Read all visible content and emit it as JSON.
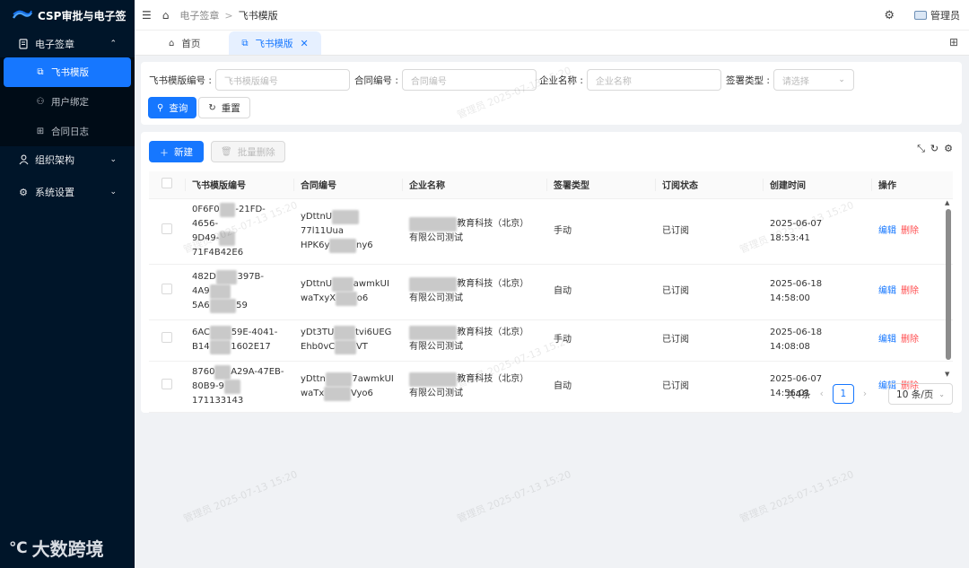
{
  "app": {
    "title": "CSP审批与电子签",
    "brand_footer": "大数跨境"
  },
  "sidebar": {
    "groups": [
      {
        "label": "电子签章",
        "arrow": "⌃",
        "items": [
          {
            "label": "飞书模版",
            "icon": "copy-icon"
          },
          {
            "label": "用户绑定",
            "icon": "user-bind-icon"
          },
          {
            "label": "合同日志",
            "icon": "grid-icon"
          }
        ]
      },
      {
        "label": "组织架构",
        "arrow": "⌄"
      },
      {
        "label": "系统设置",
        "arrow": "⌄"
      }
    ]
  },
  "header": {
    "breadcrumb": [
      "电子签章",
      "飞书模版"
    ],
    "user": "管理员"
  },
  "tabs": [
    {
      "label": "首页"
    },
    {
      "label": "飞书模版"
    }
  ],
  "search": {
    "fields": [
      {
        "label": "飞书模版编号 :",
        "placeholder": "飞书模版编号"
      },
      {
        "label": "合同编号 :",
        "placeholder": "合同编号"
      },
      {
        "label": "企业名称 :",
        "placeholder": "企业名称"
      },
      {
        "label": "签署类型 :",
        "placeholder": "请选择"
      }
    ],
    "query_label": "查询",
    "reset_label": "重置"
  },
  "toolbar": {
    "new_label": "新建",
    "batch_delete_label": "批量删除"
  },
  "table": {
    "columns": [
      "飞书模版编号",
      "合同编号",
      "企业名称",
      "签署类型",
      "订阅状态",
      "创建时间",
      "操作"
    ],
    "rows": [
      {
        "tpl1": "0F6F0",
        "tpl2": "-21FD-4656-",
        "tpl3": "9D49-",
        "tpl4": "71F4B42E6",
        "c1": "yDttnU",
        "c2": "77l11Uua",
        "c3": "HPK6y",
        "c4": "ny6",
        "e1": "教育科技（北京）",
        "e2": "有限公司测试",
        "sign": "手动",
        "status": "已订阅",
        "created": "2025-06-07 18:53:41"
      },
      {
        "tpl1": "482D",
        "tpl2": "397B-",
        "tpl3": "4A9",
        "tpl4": "59",
        "tpl5": "5A6",
        "c1": "yDttnU",
        "c2": "awmkUI",
        "c3": "waTxyX",
        "c4": "o6",
        "e1": "教育科技（北京）",
        "e2": "有限公司测试",
        "sign": "自动",
        "status": "已订阅",
        "created": "2025-06-18 14:58:00"
      },
      {
        "tpl1": "6AC",
        "tpl2": "59E-4041-",
        "tpl3": "B14",
        "tpl4": "1602E17",
        "c1": "yDt3TU",
        "c2": "tvi6UEG",
        "c3": "Ehb0vC",
        "c4": "VT",
        "e1": "教育科技（北京）",
        "e2": "有限公司测试",
        "sign": "手动",
        "status": "已订阅",
        "created": "2025-06-18 14:08:08"
      },
      {
        "tpl1": "8760",
        "tpl2": "A29A-47EB-",
        "tpl3": "80B9-9",
        "tpl4": "171133143",
        "c1": "yDttn",
        "c2": "7awmkUI",
        "c3": "waTx",
        "c4": "Vyo6",
        "e1": "教育科技（北京）",
        "e2": "有限公司测试",
        "sign": "自动",
        "status": "已订阅",
        "created": "2025-06-07 14:56:01"
      }
    ],
    "actions": {
      "edit": "编辑",
      "delete": "删除"
    }
  },
  "pagination": {
    "total": "共4条",
    "current": "1",
    "page_size": "10 条/页"
  },
  "watermark": "管理员 2025-07-13 15:20",
  "colors": {
    "primary": "#1677ff",
    "sidebar_bg": "#001529",
    "danger": "#ff4d4f"
  }
}
